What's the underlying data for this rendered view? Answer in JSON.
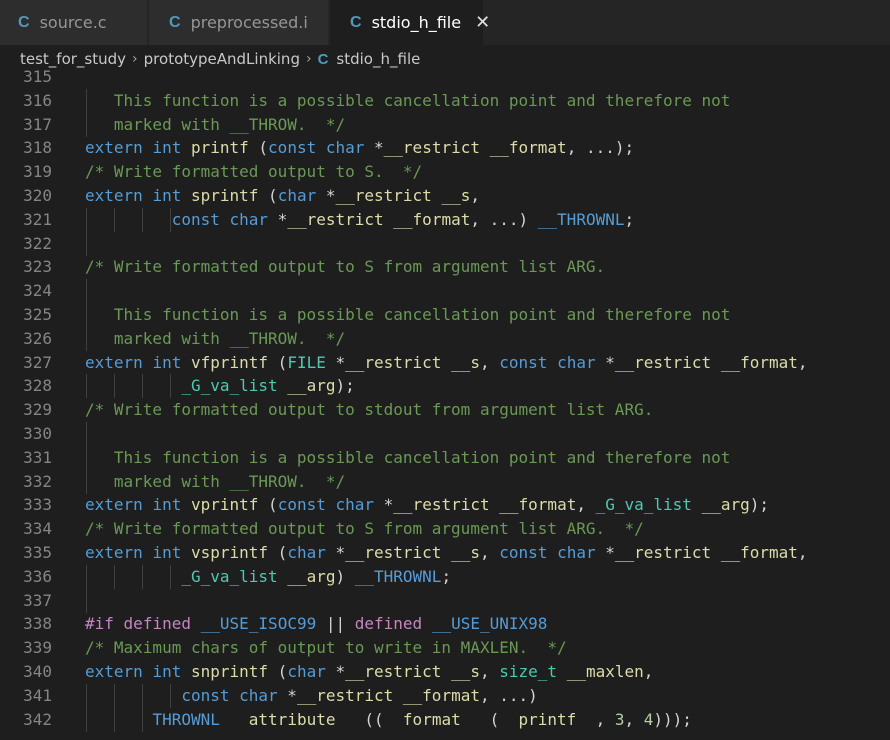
{
  "tabs": [
    {
      "icon": "C",
      "label": "source.c",
      "active": false
    },
    {
      "icon": "C",
      "label": "preprocessed.i",
      "active": false
    },
    {
      "icon": "C",
      "label": "stdio_h_file",
      "active": true,
      "close": "✕"
    }
  ],
  "breadcrumb": {
    "items": [
      "test_for_study",
      "prototypeAndLinking"
    ],
    "file_icon": "C",
    "file": "stdio_h_file",
    "separator": "›"
  },
  "editor": {
    "lines": [
      {
        "n": "315",
        "indent": 0,
        "toks": []
      },
      {
        "n": "316",
        "indent": 1,
        "toks": [
          [
            "cm",
            "   This function is a possible cancellation point and therefore not"
          ]
        ]
      },
      {
        "n": "317",
        "indent": 1,
        "toks": [
          [
            "cm",
            "   marked with __THROW.  */"
          ]
        ]
      },
      {
        "n": "318",
        "indent": 0,
        "toks": [
          [
            "kw",
            "extern"
          ],
          [
            "txt",
            " "
          ],
          [
            "kw",
            "int"
          ],
          [
            "txt",
            " "
          ],
          [
            "fn",
            "printf"
          ],
          [
            "txt",
            " ("
          ],
          [
            "kw",
            "const"
          ],
          [
            "txt",
            " "
          ],
          [
            "kw",
            "char"
          ],
          [
            "txt",
            " *"
          ],
          [
            "fn",
            "__restrict"
          ],
          [
            "txt",
            " "
          ],
          [
            "fn",
            "__format"
          ],
          [
            "txt",
            ", ...);"
          ]
        ]
      },
      {
        "n": "319",
        "indent": 0,
        "toks": [
          [
            "cm",
            "/* Write formatted output to S.  */"
          ]
        ]
      },
      {
        "n": "320",
        "indent": 0,
        "toks": [
          [
            "kw",
            "extern"
          ],
          [
            "txt",
            " "
          ],
          [
            "kw",
            "int"
          ],
          [
            "txt",
            " "
          ],
          [
            "fn",
            "sprintf"
          ],
          [
            "txt",
            " ("
          ],
          [
            "kw",
            "char"
          ],
          [
            "txt",
            " *"
          ],
          [
            "fn",
            "__restrict"
          ],
          [
            "txt",
            " "
          ],
          [
            "fn",
            "__s"
          ],
          [
            "txt",
            ","
          ]
        ]
      },
      {
        "n": "321",
        "indent": 4,
        "toks": [
          [
            "txt",
            "         "
          ],
          [
            "kw",
            "const"
          ],
          [
            "txt",
            " "
          ],
          [
            "kw",
            "char"
          ],
          [
            "txt",
            " *"
          ],
          [
            "fn",
            "__restrict"
          ],
          [
            "txt",
            " "
          ],
          [
            "fn",
            "__format"
          ],
          [
            "txt",
            ", ...) "
          ],
          [
            "mac",
            "__THROWNL"
          ],
          [
            "txt",
            ";"
          ]
        ]
      },
      {
        "n": "322",
        "indent": 1,
        "toks": []
      },
      {
        "n": "323",
        "indent": 0,
        "toks": [
          [
            "cm",
            "/* Write formatted output to S from argument list ARG."
          ]
        ]
      },
      {
        "n": "324",
        "indent": 1,
        "toks": []
      },
      {
        "n": "325",
        "indent": 1,
        "toks": [
          [
            "cm",
            "   This function is a possible cancellation point and therefore not"
          ]
        ]
      },
      {
        "n": "326",
        "indent": 1,
        "toks": [
          [
            "cm",
            "   marked with __THROW.  */"
          ]
        ]
      },
      {
        "n": "327",
        "indent": 0,
        "toks": [
          [
            "kw",
            "extern"
          ],
          [
            "txt",
            " "
          ],
          [
            "kw",
            "int"
          ],
          [
            "txt",
            " "
          ],
          [
            "fn",
            "vfprintf"
          ],
          [
            "txt",
            " ("
          ],
          [
            "ty",
            "FILE"
          ],
          [
            "txt",
            " *"
          ],
          [
            "fn",
            "__restrict"
          ],
          [
            "txt",
            " "
          ],
          [
            "fn",
            "__s"
          ],
          [
            "txt",
            ", "
          ],
          [
            "kw",
            "const"
          ],
          [
            "txt",
            " "
          ],
          [
            "kw",
            "char"
          ],
          [
            "txt",
            " *"
          ],
          [
            "fn",
            "__restrict"
          ],
          [
            "txt",
            " "
          ],
          [
            "fn",
            "__format"
          ],
          [
            "txt",
            ","
          ]
        ]
      },
      {
        "n": "328",
        "indent": 4,
        "toks": [
          [
            "txt",
            "          "
          ],
          [
            "ty",
            "_G_va_list"
          ],
          [
            "txt",
            " "
          ],
          [
            "fn",
            "__arg"
          ],
          [
            "txt",
            ");"
          ]
        ]
      },
      {
        "n": "329",
        "indent": 0,
        "toks": [
          [
            "cm",
            "/* Write formatted output to stdout from argument list ARG."
          ]
        ]
      },
      {
        "n": "330",
        "indent": 1,
        "toks": []
      },
      {
        "n": "331",
        "indent": 1,
        "toks": [
          [
            "cm",
            "   This function is a possible cancellation point and therefore not"
          ]
        ]
      },
      {
        "n": "332",
        "indent": 1,
        "toks": [
          [
            "cm",
            "   marked with __THROW.  */"
          ]
        ]
      },
      {
        "n": "333",
        "indent": 0,
        "toks": [
          [
            "kw",
            "extern"
          ],
          [
            "txt",
            " "
          ],
          [
            "kw",
            "int"
          ],
          [
            "txt",
            " "
          ],
          [
            "fn",
            "vprintf"
          ],
          [
            "txt",
            " ("
          ],
          [
            "kw",
            "const"
          ],
          [
            "txt",
            " "
          ],
          [
            "kw",
            "char"
          ],
          [
            "txt",
            " *"
          ],
          [
            "fn",
            "__restrict"
          ],
          [
            "txt",
            " "
          ],
          [
            "fn",
            "__format"
          ],
          [
            "txt",
            ", "
          ],
          [
            "ty",
            "_G_va_list"
          ],
          [
            "txt",
            " "
          ],
          [
            "fn",
            "__arg"
          ],
          [
            "txt",
            ");"
          ]
        ]
      },
      {
        "n": "334",
        "indent": 0,
        "toks": [
          [
            "cm",
            "/* Write formatted output to S from argument list ARG.  */"
          ]
        ]
      },
      {
        "n": "335",
        "indent": 0,
        "toks": [
          [
            "kw",
            "extern"
          ],
          [
            "txt",
            " "
          ],
          [
            "kw",
            "int"
          ],
          [
            "txt",
            " "
          ],
          [
            "fn",
            "vsprintf"
          ],
          [
            "txt",
            " ("
          ],
          [
            "kw",
            "char"
          ],
          [
            "txt",
            " *"
          ],
          [
            "fn",
            "__restrict"
          ],
          [
            "txt",
            " "
          ],
          [
            "fn",
            "__s"
          ],
          [
            "txt",
            ", "
          ],
          [
            "kw",
            "const"
          ],
          [
            "txt",
            " "
          ],
          [
            "kw",
            "char"
          ],
          [
            "txt",
            " *"
          ],
          [
            "fn",
            "__restrict"
          ],
          [
            "txt",
            " "
          ],
          [
            "fn",
            "__format"
          ],
          [
            "txt",
            ","
          ]
        ]
      },
      {
        "n": "336",
        "indent": 4,
        "toks": [
          [
            "txt",
            "          "
          ],
          [
            "ty",
            "_G_va_list"
          ],
          [
            "txt",
            " "
          ],
          [
            "fn",
            "__arg"
          ],
          [
            "txt",
            ") "
          ],
          [
            "mac",
            "__THROWNL"
          ],
          [
            "txt",
            ";"
          ]
        ]
      },
      {
        "n": "337",
        "indent": 1,
        "toks": []
      },
      {
        "n": "338",
        "indent": 0,
        "toks": [
          [
            "pp",
            "#if"
          ],
          [
            "txt",
            " "
          ],
          [
            "pp",
            "defined"
          ],
          [
            "txt",
            " "
          ],
          [
            "mac",
            "__USE_ISOC99"
          ],
          [
            "txt",
            " || "
          ],
          [
            "pp",
            "defined"
          ],
          [
            "txt",
            " "
          ],
          [
            "mac",
            "__USE_UNIX98"
          ]
        ]
      },
      {
        "n": "339",
        "indent": 0,
        "toks": [
          [
            "cm",
            "/* Maximum chars of output to write in MAXLEN.  */"
          ]
        ]
      },
      {
        "n": "340",
        "indent": 0,
        "toks": [
          [
            "kw",
            "extern"
          ],
          [
            "txt",
            " "
          ],
          [
            "kw",
            "int"
          ],
          [
            "txt",
            " "
          ],
          [
            "fn",
            "snprintf"
          ],
          [
            "txt",
            " ("
          ],
          [
            "kw",
            "char"
          ],
          [
            "txt",
            " *"
          ],
          [
            "fn",
            "__restrict"
          ],
          [
            "txt",
            " "
          ],
          [
            "fn",
            "__s"
          ],
          [
            "txt",
            ", "
          ],
          [
            "ty",
            "size_t"
          ],
          [
            "txt",
            " "
          ],
          [
            "fn",
            "__maxlen"
          ],
          [
            "txt",
            ","
          ]
        ]
      },
      {
        "n": "341",
        "indent": 4,
        "toks": [
          [
            "txt",
            "          "
          ],
          [
            "kw",
            "const"
          ],
          [
            "txt",
            " "
          ],
          [
            "kw",
            "char"
          ],
          [
            "txt",
            " *"
          ],
          [
            "fn",
            "__restrict"
          ],
          [
            "txt",
            " "
          ],
          [
            "fn",
            "__format"
          ],
          [
            "txt",
            ", ...)"
          ]
        ]
      },
      {
        "n": "342",
        "indent": 3,
        "toks": [
          [
            "txt",
            "       "
          ],
          [
            "mac",
            "THROWNL"
          ],
          [
            "txt",
            "   "
          ],
          [
            "fn",
            "attribute"
          ],
          [
            "txt",
            "   ((  "
          ],
          [
            "fn",
            "format"
          ],
          [
            "txt",
            "   (  "
          ],
          [
            "fn",
            "printf"
          ],
          [
            "txt",
            "  , "
          ],
          [
            "num",
            "3"
          ],
          [
            "txt",
            ", "
          ],
          [
            "num",
            "4"
          ],
          [
            "txt",
            ")));"
          ]
        ]
      }
    ]
  }
}
